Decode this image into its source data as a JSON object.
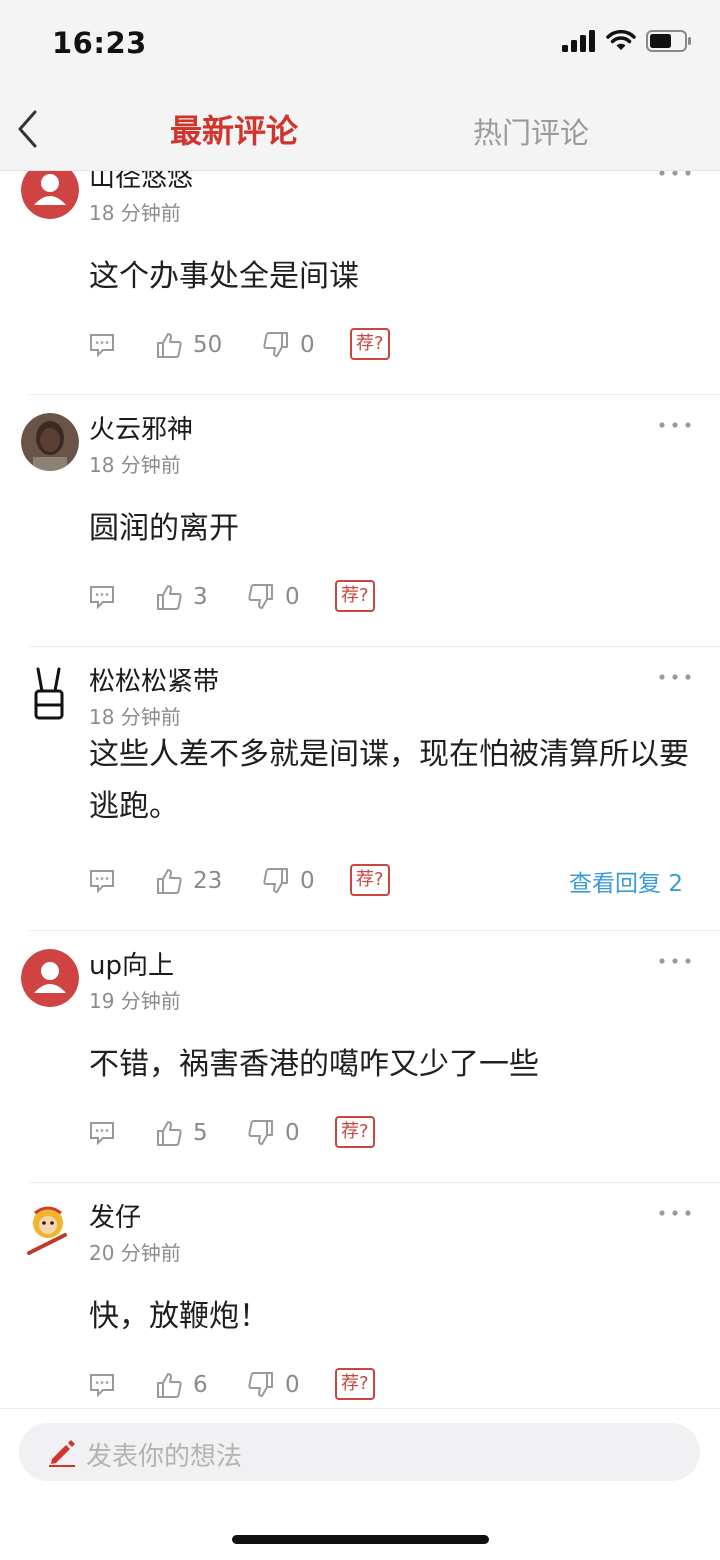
{
  "status": {
    "time": "16:23"
  },
  "nav": {
    "tab_latest": "最新评论",
    "tab_hot": "热门评论"
  },
  "comments": [
    {
      "username": "山径悠悠",
      "time": "18 分钟前",
      "content": "这个办事处全是间谍",
      "likes": "50",
      "dislikes": "0",
      "tui": "荐?",
      "avatar": "default-avatar"
    },
    {
      "username": "火云邪神",
      "time": "18 分钟前",
      "content": "圆润的离开",
      "likes": "3",
      "dislikes": "0",
      "tui": "荐?",
      "avatar": "photo-avatar"
    },
    {
      "username": "松松松紧带",
      "time": "18 分钟前",
      "content": "这些人差不多就是间谍，现在怕被清算所以要逃跑。",
      "likes": "23",
      "dislikes": "0",
      "tui": "荐?",
      "replies": "查看回复 2",
      "avatar": "sketch-avatar"
    },
    {
      "username": "up向上",
      "time": "19 分钟前",
      "content": "不错，祸害香港的噶咋又少了一些",
      "likes": "5",
      "dislikes": "0",
      "tui": "荐?",
      "avatar": "default-avatar"
    },
    {
      "username": "发仔",
      "time": "20 分钟前",
      "content": "快，放鞭炮！",
      "likes": "6",
      "dislikes": "0",
      "tui": "荐?",
      "avatar": "monkey-king-avatar"
    }
  ],
  "input": {
    "placeholder": "发表你的想法"
  },
  "colors": {
    "accent": "#d0342c",
    "link": "#3a9bd9",
    "muted": "#8c8c8c"
  }
}
